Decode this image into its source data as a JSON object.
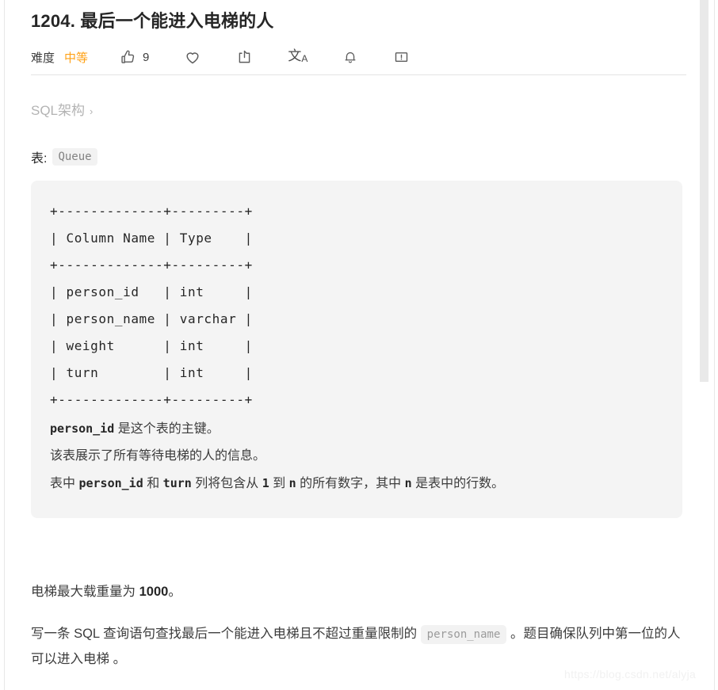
{
  "problem": {
    "title": "1204. 最后一个能进入电梯的人",
    "difficulty_label": "难度",
    "difficulty_value": "中等",
    "difficulty_color": "#ffa116"
  },
  "toolbar": {
    "like": {
      "icon": "thumbs-up-icon",
      "count": "9"
    },
    "favorite": {
      "icon": "heart-icon"
    },
    "share": {
      "icon": "share-icon"
    },
    "translate": {
      "icon": "translate-icon",
      "glyph": "文",
      "sub": "A"
    },
    "notify": {
      "icon": "bell-icon"
    },
    "feedback": {
      "icon": "comment-icon"
    }
  },
  "breadcrumb": {
    "label": "SQL架构",
    "chevron": "›"
  },
  "schema": {
    "caption": "表:",
    "table_name": "Queue",
    "ascii": "+-------------+---------+\n| Column Name | Type    |\n+-------------+---------+\n| person_id   | int     |\n| person_name | varchar |\n| weight      | int     |\n| turn        | int     |\n+-------------+---------+",
    "columns": [
      {
        "name": "person_id",
        "type": "int"
      },
      {
        "name": "person_name",
        "type": "varchar"
      },
      {
        "name": "weight",
        "type": "int"
      },
      {
        "name": "turn",
        "type": "int"
      }
    ],
    "notes": {
      "line1_code": "person_id",
      "line1_text": "是这个表的主键。",
      "line2": "该表展示了所有等待电梯的人的信息。",
      "line3_a": "表中",
      "line3_code1": "person_id",
      "line3_b": "和",
      "line3_code2": "turn",
      "line3_c": "列将包含从",
      "line3_code3": "1",
      "line3_d": "到",
      "line3_code4": "n",
      "line3_e": "的所有数字，其中",
      "line3_code5": "n",
      "line3_f": "是表中的行数。"
    }
  },
  "body": {
    "para1_a": "电梯最大载重量为 ",
    "para1_bold": "1000",
    "para1_b": "。",
    "para2_a": "写一条 SQL 查询语句查找最后一个能进入电梯且不超过重量限制的 ",
    "para2_code": "person_name",
    "para2_b": " 。题目确保队列中第一位的人可以进入电梯 。"
  },
  "watermark": {
    "text": "https://blog.csdn.net/alyja"
  }
}
